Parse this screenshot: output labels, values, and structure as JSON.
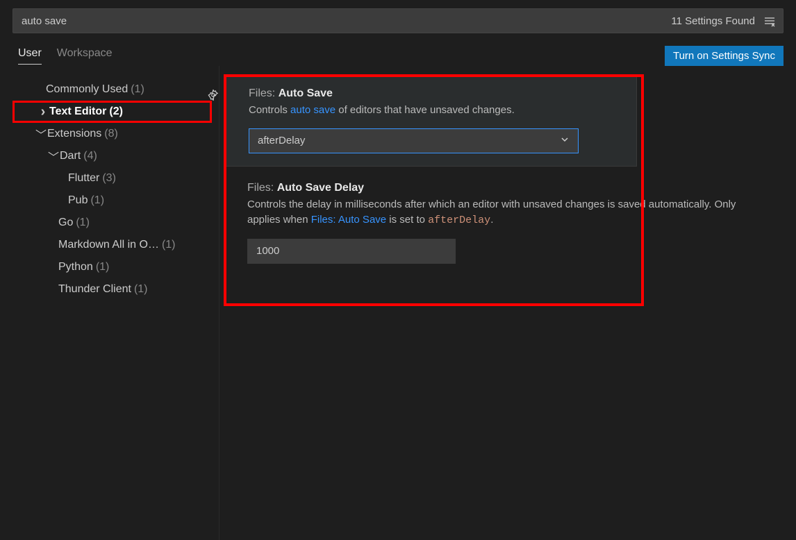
{
  "search": {
    "value": "auto save",
    "status": "11 Settings Found"
  },
  "tabs": {
    "user": "User",
    "workspace": "Workspace"
  },
  "syncButton": "Turn on Settings Sync",
  "sidebar": {
    "items": [
      {
        "label": "Commonly Used",
        "count": "(1)",
        "indent": "indent-0"
      },
      {
        "label": "Text Editor",
        "count": "(2)",
        "chevron": "▸",
        "indent": "indent-1c",
        "highlighted": true
      },
      {
        "label": "Extensions",
        "count": "(8)",
        "chevron": "﹀",
        "indent": "indent-1c"
      },
      {
        "label": "Dart",
        "count": "(4)",
        "chevron": "﹀",
        "indent": "indent-2c"
      },
      {
        "label": "Flutter",
        "count": "(3)",
        "indent": "indent-3"
      },
      {
        "label": "Pub",
        "count": "(1)",
        "indent": "indent-3"
      },
      {
        "label": "Go",
        "count": "(1)",
        "indent": "indent-2"
      },
      {
        "label": "Markdown All in O…",
        "count": "(1)",
        "indent": "indent-2"
      },
      {
        "label": "Python",
        "count": "(1)",
        "indent": "indent-2"
      },
      {
        "label": "Thunder Client",
        "count": "(1)",
        "indent": "indent-2"
      }
    ]
  },
  "settings": {
    "autoSave": {
      "titlePrefix": "Files:",
      "titleMain": "Auto Save",
      "desc1": "Controls ",
      "descLink": "auto save",
      "desc2": " of editors that have unsaved changes.",
      "value": "afterDelay"
    },
    "autoSaveDelay": {
      "titlePrefix": "Files:",
      "titleMain": "Auto Save Delay",
      "desc1": "Controls the delay in milliseconds after which an editor with unsaved changes is saved automatically. Only applies when ",
      "descLink": "Files: Auto Save",
      "desc2": " is set to ",
      "descCode": "afterDelay",
      "desc3": ".",
      "value": "1000"
    }
  }
}
